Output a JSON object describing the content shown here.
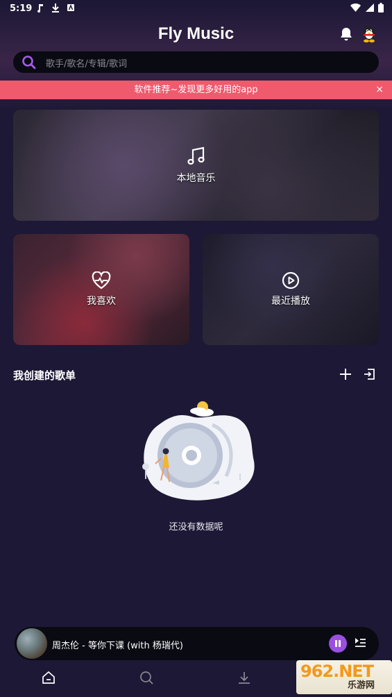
{
  "status_bar": {
    "time": "5:19"
  },
  "header": {
    "title": "Fly Music"
  },
  "search": {
    "placeholder": "歌手/歌名/专辑/歌词"
  },
  "banner": {
    "text": "软件推荐~发现更多好用的app",
    "close": "×"
  },
  "cards": {
    "local": "本地音乐",
    "favorites": "我喜欢",
    "recent": "最近播放"
  },
  "playlists": {
    "title": "我创建的歌单",
    "empty_text": "还没有数据呢"
  },
  "player": {
    "song": "周杰伦 - 等你下课 (with 杨瑞代)",
    "playing": true
  },
  "watermark": {
    "number": "962.NET",
    "name": "乐游网"
  },
  "colors": {
    "background": "#1d1835",
    "accent": "#9b4fe0",
    "banner": "#ef5a6d"
  }
}
